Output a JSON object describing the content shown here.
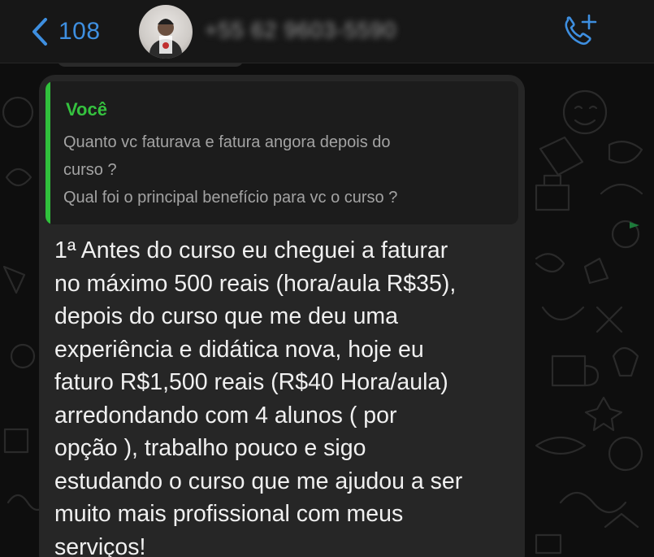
{
  "header": {
    "back_count": "108",
    "contact_name": "+55 62 9603-5590"
  },
  "colors": {
    "accent_blue": "#3e8fe0",
    "quote_green": "#35c23f",
    "bubble": "#262626"
  },
  "icons": {
    "back": "chevron-left-icon",
    "call": "phone-plus-icon"
  },
  "message": {
    "quote": {
      "author": "Você",
      "lines": [
        "Quanto vc faturava e fatura angora depois do",
        "curso ?",
        "Qual foi o principal benefício para vc o curso ?"
      ]
    },
    "lines": [
      "1ª Antes do curso eu cheguei a faturar",
      "no máximo 500 reais (hora/aula R$35),",
      "depois do curso que me deu uma",
      "experiência e didática nova, hoje eu",
      "faturo R$1,500 reais (R$40 Hora/aula)",
      "arredondando com 4 alunos ( por",
      "opção ), trabalho pouco e sigo",
      "estudando o curso que me ajudou a ser",
      "muito mais profissional com meus",
      "serviços!"
    ]
  }
}
